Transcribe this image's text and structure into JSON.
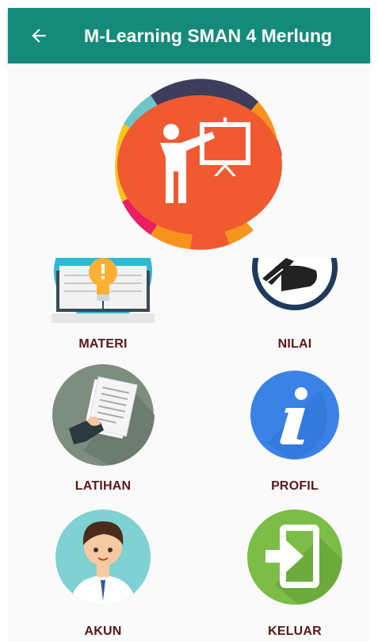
{
  "app_bar": {
    "title": "M-Learning SMAN 4 Merlung",
    "back_icon": "arrow-left-icon",
    "background": "#138a7a"
  },
  "logo": {
    "icon": "teacher-presentation-icon",
    "colors": [
      "#f15a31",
      "#3d3d5c",
      "#f7941d",
      "#e91e63",
      "#fcc419",
      "#6cc5c9"
    ]
  },
  "menu": [
    {
      "id": "materi",
      "label": "MATERI",
      "icon": "book-lightbulb-icon"
    },
    {
      "id": "nilai",
      "label": "NILAI",
      "icon": "pen-writing-icon"
    },
    {
      "id": "latihan",
      "label": "LATIHAN",
      "icon": "document-hand-icon"
    },
    {
      "id": "profil",
      "label": "PROFIL",
      "icon": "info-icon"
    },
    {
      "id": "akun",
      "label": "AKUN",
      "icon": "user-avatar-icon"
    },
    {
      "id": "keluar",
      "label": "KELUAR",
      "icon": "exit-icon"
    }
  ],
  "label_color": "#5a1818"
}
